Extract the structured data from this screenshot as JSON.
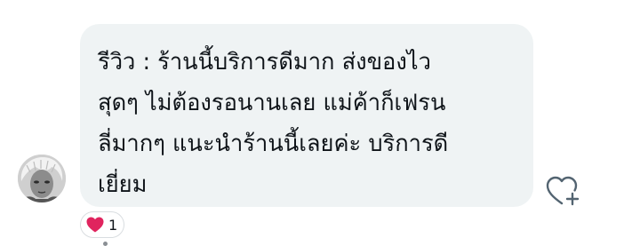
{
  "comment": {
    "text_lines": [
      "รีวิว : ร้านนี้บริการดีมาก ส่งของไว",
      "สุดๆ ไม่ต้องรอนานเลย แม่ค้าก็เฟรน",
      "ลี่มากๆ แนะนำร้านนี้เลยค่ะ บริการดี",
      "เยี่ยม"
    ],
    "reaction": {
      "icon": "heart-icon",
      "count": "1",
      "color": "#e0245e"
    },
    "like_action_icon": "heart-plus-icon",
    "bubble_color": "#eff3f4"
  }
}
